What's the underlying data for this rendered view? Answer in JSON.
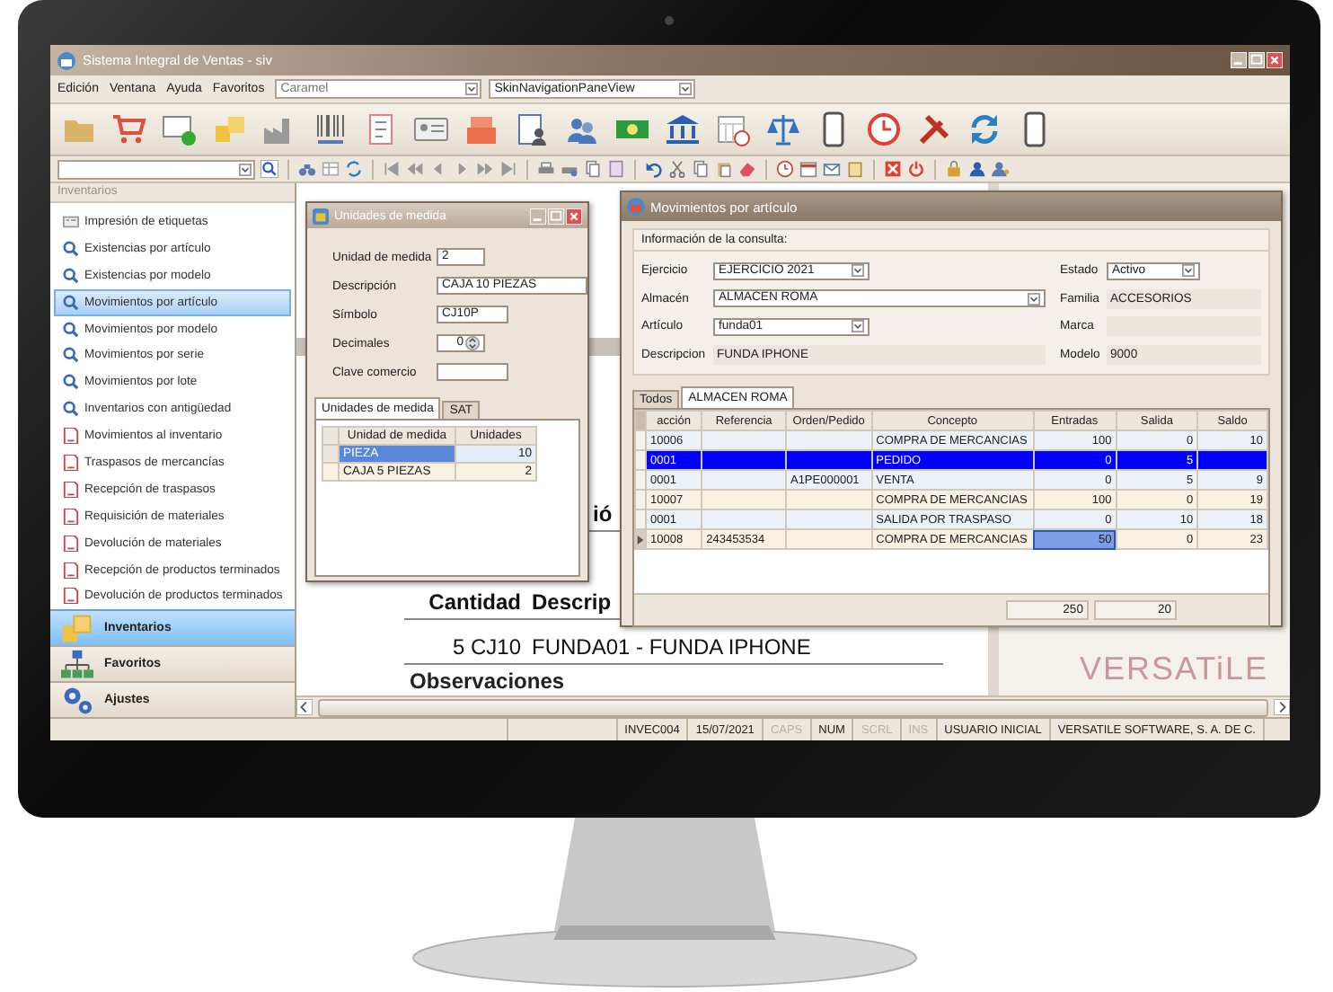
{
  "window": {
    "title": "Sistema Integral de Ventas - siv"
  },
  "menu": [
    "Edición",
    "Ventana",
    "Ayuda",
    "Favoritos"
  ],
  "skin_combo": {
    "value": "Caramel"
  },
  "view_combo": {
    "value": "SkinNavigationPaneView"
  },
  "sidebar": {
    "header": "Inventarios",
    "items": [
      {
        "label": "Impresión de etiquetas",
        "kind": "label",
        "selected": false
      },
      {
        "label": "Existencias por artículo",
        "kind": "search",
        "selected": false
      },
      {
        "label": "Existencias por modelo",
        "kind": "search",
        "selected": false
      },
      {
        "label": "Movimientos por artículo",
        "kind": "search",
        "selected": true
      },
      {
        "label": "Movimientos por modelo",
        "kind": "search",
        "selected": false
      },
      {
        "label": "Movimientos por serie",
        "kind": "search",
        "selected": false
      },
      {
        "label": "Movimientos por lote",
        "kind": "search",
        "selected": false
      },
      {
        "label": "Inventarios con antigüedad",
        "kind": "search",
        "selected": false
      },
      {
        "label": "Movimientos al inventario",
        "kind": "document",
        "selected": false
      },
      {
        "label": "Traspasos de mercancías",
        "kind": "document",
        "selected": false
      },
      {
        "label": "Recepción de traspasos",
        "kind": "document",
        "selected": false
      },
      {
        "label": "Requisición de materiales",
        "kind": "document",
        "selected": false
      },
      {
        "label": "Devolución de materiales",
        "kind": "document",
        "selected": false
      },
      {
        "label": "Recepción de productos terminados",
        "kind": "document",
        "selected": false
      },
      {
        "label": "Devolución de productos terminados",
        "kind": "document",
        "selected": false
      }
    ],
    "sections": [
      {
        "label": "Inventarios",
        "selected": true
      },
      {
        "label": "Favoritos",
        "selected": false
      },
      {
        "label": "Ajustes",
        "selected": false
      }
    ]
  },
  "report": {
    "heading": "ió",
    "columns": [
      "Cantidad",
      "Descrip"
    ],
    "line": [
      "5 CJ10",
      "FUNDA01 - FUNDA IPHONE"
    ],
    "section": "Observaciones",
    "logo": "VERSATiLE"
  },
  "units_window": {
    "title": "Unidades de medida",
    "fields": [
      {
        "label": "Unidad de medida",
        "value": "2",
        "kind": "short"
      },
      {
        "label": "Descripción",
        "value": "CAJA 10 PIEZAS",
        "kind": "long"
      },
      {
        "label": "Símbolo",
        "value": "CJ10P",
        "kind": "medium"
      },
      {
        "label": "Decimales",
        "value": "0",
        "kind": "spinner"
      },
      {
        "label": "Clave comercio",
        "kind": "medium"
      }
    ],
    "tabs": [
      {
        "label": "Unidades de medida",
        "selected": true
      },
      {
        "label": "SAT",
        "selected": false
      }
    ],
    "grid": {
      "columns": [
        "Unidad de medida",
        "Unidades"
      ],
      "rows": [
        {
          "cells": [
            "PIEZA",
            "10"
          ],
          "selected": true
        },
        {
          "cells": [
            "CAJA 5 PIEZAS",
            "2"
          ],
          "selected": false
        }
      ]
    }
  },
  "movements_window": {
    "title": "Movimientos por artículo",
    "group_title": "Información de la consulta:",
    "left_fields": [
      {
        "label": "Ejercicio",
        "value": "EJERCICIO 2021",
        "kind": "combo"
      },
      {
        "label": "Almacén",
        "value": "ALMACEN ROMA",
        "kind": "wide_combo"
      },
      {
        "label": "Artículo",
        "value": "funda01",
        "kind": "combo"
      },
      {
        "label": "Descripcion",
        "value": "FUNDA IPHONE",
        "kind": "display"
      }
    ],
    "right_fields": [
      {
        "label": "Estado",
        "value": "Activo",
        "kind": "combo"
      },
      {
        "label": "Familia",
        "value": "ACCESORIOS",
        "kind": "display"
      },
      {
        "label": "Marca",
        "kind": "display"
      },
      {
        "label": "Modelo",
        "value": "9000",
        "kind": "display"
      }
    ],
    "tabs": [
      {
        "label": "Todos",
        "selected": false
      },
      {
        "label": "ALMACEN ROMA",
        "selected": true
      }
    ],
    "grid": {
      "columns": [
        "acción",
        "Referencia",
        "Orden/Pedido",
        "Concepto",
        "Entradas",
        "Salida",
        "Saldo"
      ],
      "rows": [
        {
          "selected": false,
          "current": false,
          "cells": [
            {
              "text": "10006",
              "focused": false
            },
            {
              "focused": false
            },
            {
              "focused": false
            },
            {
              "text": "COMPRA DE MERCANCIAS",
              "focused": false
            },
            {
              "text": "100",
              "focused": false
            },
            {
              "text": "0",
              "focused": false
            },
            {
              "text": "10",
              "focused": false
            }
          ]
        },
        {
          "selected": true,
          "current": false,
          "cells": [
            {
              "text": "0001",
              "focused": false
            },
            {
              "focused": false
            },
            {
              "focused": false
            },
            {
              "text": "PEDIDO",
              "focused": false
            },
            {
              "text": "0",
              "focused": false
            },
            {
              "text": "5",
              "focused": false
            },
            {
              "focused": false
            }
          ]
        },
        {
          "selected": false,
          "current": false,
          "cells": [
            {
              "text": "0001",
              "focused": false
            },
            {
              "focused": false
            },
            {
              "text": "A1PE000001",
              "focused": false
            },
            {
              "text": "VENTA",
              "focused": false
            },
            {
              "text": "0",
              "focused": false
            },
            {
              "text": "5",
              "focused": false
            },
            {
              "text": "9",
              "focused": false
            }
          ]
        },
        {
          "selected": false,
          "current": false,
          "cells": [
            {
              "text": "10007",
              "focused": false
            },
            {
              "focused": false
            },
            {
              "focused": false
            },
            {
              "text": "COMPRA DE MERCANCIAS",
              "focused": false
            },
            {
              "text": "100",
              "focused": false
            },
            {
              "text": "0",
              "focused": false
            },
            {
              "text": "19",
              "focused": false
            }
          ]
        },
        {
          "selected": false,
          "current": false,
          "cells": [
            {
              "text": "0001",
              "focused": false
            },
            {
              "focused": false
            },
            {
              "focused": false
            },
            {
              "text": "SALIDA POR TRASPASO",
              "focused": false
            },
            {
              "text": "0",
              "focused": false
            },
            {
              "text": "10",
              "focused": false
            },
            {
              "text": "18",
              "focused": false
            }
          ]
        },
        {
          "selected": false,
          "current": true,
          "cells": [
            {
              "text": "10008",
              "focused": false
            },
            {
              "text": "243453534",
              "focused": false
            },
            {
              "focused": false
            },
            {
              "text": "COMPRA DE MERCANCIAS",
              "focused": false
            },
            {
              "text": "50",
              "focused": true
            },
            {
              "text": "0",
              "focused": false
            },
            {
              "text": "23",
              "focused": false
            }
          ]
        }
      ],
      "totals": [
        "250",
        "20"
      ]
    }
  },
  "status_bar": [
    {
      "text": "INVEC004",
      "disabled": false
    },
    {
      "text": "15/07/2021",
      "disabled": false
    },
    {
      "text": "CAPS",
      "disabled": true
    },
    {
      "text": "NUM",
      "disabled": false
    },
    {
      "text": "SCRL",
      "disabled": true
    },
    {
      "text": "INS",
      "disabled": true
    },
    {
      "text": "USUARIO INICIAL",
      "disabled": false
    },
    {
      "text": "VERSATILE SOFTWARE, S. A. DE C.",
      "disabled": false
    }
  ]
}
